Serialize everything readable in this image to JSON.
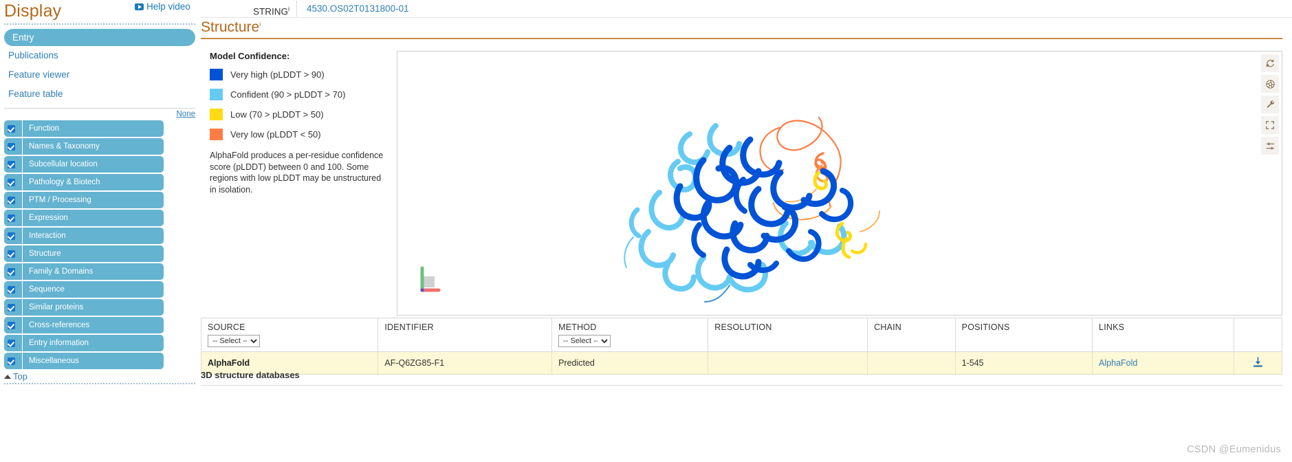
{
  "sidebar": {
    "title": "Display",
    "help_video": "Help video",
    "help_video_icon": "youtube-play-icon",
    "entry_label": "Entry",
    "links": [
      "Publications",
      "Feature viewer",
      "Feature table"
    ],
    "none_label": "None",
    "categories": [
      {
        "label": "Function",
        "checked": true
      },
      {
        "label": "Names & Taxonomy",
        "checked": true
      },
      {
        "label": "Subcellular location",
        "checked": true
      },
      {
        "label": "Pathology & Biotech",
        "checked": true
      },
      {
        "label": "PTM / Processing",
        "checked": true
      },
      {
        "label": "Expression",
        "checked": true
      },
      {
        "label": "Interaction",
        "checked": true
      },
      {
        "label": "Structure",
        "checked": true
      },
      {
        "label": "Family & Domains",
        "checked": true
      },
      {
        "label": "Sequence",
        "checked": true
      },
      {
        "label": "Similar proteins",
        "checked": true
      },
      {
        "label": "Cross-references",
        "checked": true
      },
      {
        "label": "Entry information",
        "checked": true
      },
      {
        "label": "Miscellaneous",
        "checked": true
      }
    ],
    "top_label": "Top"
  },
  "header": {
    "string_label": "STRING",
    "string_value": "4530.OS02T0131800-01"
  },
  "main": {
    "section_title": "Structure",
    "db_section_title": "3D structure databases"
  },
  "legend": {
    "title": "Model Confidence:",
    "items": [
      {
        "label": "Very high (pLDDT > 90)",
        "color": "#0053d6"
      },
      {
        "label": "Confident (90 > pLDDT > 70)",
        "color": "#65cbf3"
      },
      {
        "label": "Low (70 > pLDDT > 50)",
        "color": "#ffdb13"
      },
      {
        "label": "Very low (pLDDT < 50)",
        "color": "#ff7d45"
      }
    ],
    "description": "AlphaFold produces a per-residue confidence score (pLDDT) between 0 and 100. Some regions with low pLDDT may be unstructured in isolation."
  },
  "viewer": {
    "toolbar": [
      {
        "name": "reset-view-icon",
        "title": "Reset"
      },
      {
        "name": "screenshot-icon",
        "title": "Screenshot"
      },
      {
        "name": "wrench-icon",
        "title": "Tools"
      },
      {
        "name": "fullscreen-icon",
        "title": "Fullscreen"
      },
      {
        "name": "settings-sliders-icon",
        "title": "Settings"
      }
    ],
    "axis_indicator": "xyz-axis-indicator"
  },
  "table": {
    "headers": [
      "SOURCE",
      "IDENTIFIER",
      "METHOD",
      "RESOLUTION",
      "CHAIN",
      "POSITIONS",
      "LINKS",
      ""
    ],
    "filters": {
      "source": "-- Select --",
      "method": "-- Select --"
    },
    "rows": [
      {
        "source": "AlphaFold",
        "identifier": "AF-Q6ZG85-F1",
        "method": "Predicted",
        "resolution": "",
        "chain": "",
        "positions": "1-545",
        "links": "AlphaFold",
        "download_icon": "download-icon"
      }
    ]
  },
  "watermark": "CSDN @Eumenidus"
}
